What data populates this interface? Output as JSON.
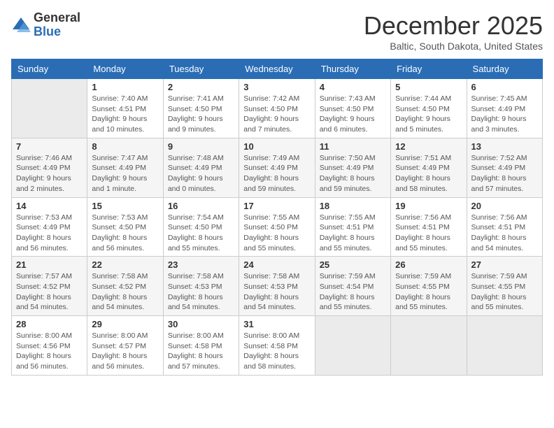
{
  "logo": {
    "general": "General",
    "blue": "Blue"
  },
  "title": "December 2025",
  "location": "Baltic, South Dakota, United States",
  "days_of_week": [
    "Sunday",
    "Monday",
    "Tuesday",
    "Wednesday",
    "Thursday",
    "Friday",
    "Saturday"
  ],
  "weeks": [
    [
      {
        "day": "",
        "sunrise": "",
        "sunset": "",
        "daylight": ""
      },
      {
        "day": "1",
        "sunrise": "Sunrise: 7:40 AM",
        "sunset": "Sunset: 4:51 PM",
        "daylight": "Daylight: 9 hours and 10 minutes."
      },
      {
        "day": "2",
        "sunrise": "Sunrise: 7:41 AM",
        "sunset": "Sunset: 4:50 PM",
        "daylight": "Daylight: 9 hours and 9 minutes."
      },
      {
        "day": "3",
        "sunrise": "Sunrise: 7:42 AM",
        "sunset": "Sunset: 4:50 PM",
        "daylight": "Daylight: 9 hours and 7 minutes."
      },
      {
        "day": "4",
        "sunrise": "Sunrise: 7:43 AM",
        "sunset": "Sunset: 4:50 PM",
        "daylight": "Daylight: 9 hours and 6 minutes."
      },
      {
        "day": "5",
        "sunrise": "Sunrise: 7:44 AM",
        "sunset": "Sunset: 4:50 PM",
        "daylight": "Daylight: 9 hours and 5 minutes."
      },
      {
        "day": "6",
        "sunrise": "Sunrise: 7:45 AM",
        "sunset": "Sunset: 4:49 PM",
        "daylight": "Daylight: 9 hours and 3 minutes."
      }
    ],
    [
      {
        "day": "7",
        "sunrise": "Sunrise: 7:46 AM",
        "sunset": "Sunset: 4:49 PM",
        "daylight": "Daylight: 9 hours and 2 minutes."
      },
      {
        "day": "8",
        "sunrise": "Sunrise: 7:47 AM",
        "sunset": "Sunset: 4:49 PM",
        "daylight": "Daylight: 9 hours and 1 minute."
      },
      {
        "day": "9",
        "sunrise": "Sunrise: 7:48 AM",
        "sunset": "Sunset: 4:49 PM",
        "daylight": "Daylight: 9 hours and 0 minutes."
      },
      {
        "day": "10",
        "sunrise": "Sunrise: 7:49 AM",
        "sunset": "Sunset: 4:49 PM",
        "daylight": "Daylight: 8 hours and 59 minutes."
      },
      {
        "day": "11",
        "sunrise": "Sunrise: 7:50 AM",
        "sunset": "Sunset: 4:49 PM",
        "daylight": "Daylight: 8 hours and 59 minutes."
      },
      {
        "day": "12",
        "sunrise": "Sunrise: 7:51 AM",
        "sunset": "Sunset: 4:49 PM",
        "daylight": "Daylight: 8 hours and 58 minutes."
      },
      {
        "day": "13",
        "sunrise": "Sunrise: 7:52 AM",
        "sunset": "Sunset: 4:49 PM",
        "daylight": "Daylight: 8 hours and 57 minutes."
      }
    ],
    [
      {
        "day": "14",
        "sunrise": "Sunrise: 7:53 AM",
        "sunset": "Sunset: 4:49 PM",
        "daylight": "Daylight: 8 hours and 56 minutes."
      },
      {
        "day": "15",
        "sunrise": "Sunrise: 7:53 AM",
        "sunset": "Sunset: 4:50 PM",
        "daylight": "Daylight: 8 hours and 56 minutes."
      },
      {
        "day": "16",
        "sunrise": "Sunrise: 7:54 AM",
        "sunset": "Sunset: 4:50 PM",
        "daylight": "Daylight: 8 hours and 55 minutes."
      },
      {
        "day": "17",
        "sunrise": "Sunrise: 7:55 AM",
        "sunset": "Sunset: 4:50 PM",
        "daylight": "Daylight: 8 hours and 55 minutes."
      },
      {
        "day": "18",
        "sunrise": "Sunrise: 7:55 AM",
        "sunset": "Sunset: 4:51 PM",
        "daylight": "Daylight: 8 hours and 55 minutes."
      },
      {
        "day": "19",
        "sunrise": "Sunrise: 7:56 AM",
        "sunset": "Sunset: 4:51 PM",
        "daylight": "Daylight: 8 hours and 55 minutes."
      },
      {
        "day": "20",
        "sunrise": "Sunrise: 7:56 AM",
        "sunset": "Sunset: 4:51 PM",
        "daylight": "Daylight: 8 hours and 54 minutes."
      }
    ],
    [
      {
        "day": "21",
        "sunrise": "Sunrise: 7:57 AM",
        "sunset": "Sunset: 4:52 PM",
        "daylight": "Daylight: 8 hours and 54 minutes."
      },
      {
        "day": "22",
        "sunrise": "Sunrise: 7:58 AM",
        "sunset": "Sunset: 4:52 PM",
        "daylight": "Daylight: 8 hours and 54 minutes."
      },
      {
        "day": "23",
        "sunrise": "Sunrise: 7:58 AM",
        "sunset": "Sunset: 4:53 PM",
        "daylight": "Daylight: 8 hours and 54 minutes."
      },
      {
        "day": "24",
        "sunrise": "Sunrise: 7:58 AM",
        "sunset": "Sunset: 4:53 PM",
        "daylight": "Daylight: 8 hours and 54 minutes."
      },
      {
        "day": "25",
        "sunrise": "Sunrise: 7:59 AM",
        "sunset": "Sunset: 4:54 PM",
        "daylight": "Daylight: 8 hours and 55 minutes."
      },
      {
        "day": "26",
        "sunrise": "Sunrise: 7:59 AM",
        "sunset": "Sunset: 4:55 PM",
        "daylight": "Daylight: 8 hours and 55 minutes."
      },
      {
        "day": "27",
        "sunrise": "Sunrise: 7:59 AM",
        "sunset": "Sunset: 4:55 PM",
        "daylight": "Daylight: 8 hours and 55 minutes."
      }
    ],
    [
      {
        "day": "28",
        "sunrise": "Sunrise: 8:00 AM",
        "sunset": "Sunset: 4:56 PM",
        "daylight": "Daylight: 8 hours and 56 minutes."
      },
      {
        "day": "29",
        "sunrise": "Sunrise: 8:00 AM",
        "sunset": "Sunset: 4:57 PM",
        "daylight": "Daylight: 8 hours and 56 minutes."
      },
      {
        "day": "30",
        "sunrise": "Sunrise: 8:00 AM",
        "sunset": "Sunset: 4:58 PM",
        "daylight": "Daylight: 8 hours and 57 minutes."
      },
      {
        "day": "31",
        "sunrise": "Sunrise: 8:00 AM",
        "sunset": "Sunset: 4:58 PM",
        "daylight": "Daylight: 8 hours and 58 minutes."
      },
      {
        "day": "",
        "sunrise": "",
        "sunset": "",
        "daylight": ""
      },
      {
        "day": "",
        "sunrise": "",
        "sunset": "",
        "daylight": ""
      },
      {
        "day": "",
        "sunrise": "",
        "sunset": "",
        "daylight": ""
      }
    ]
  ]
}
